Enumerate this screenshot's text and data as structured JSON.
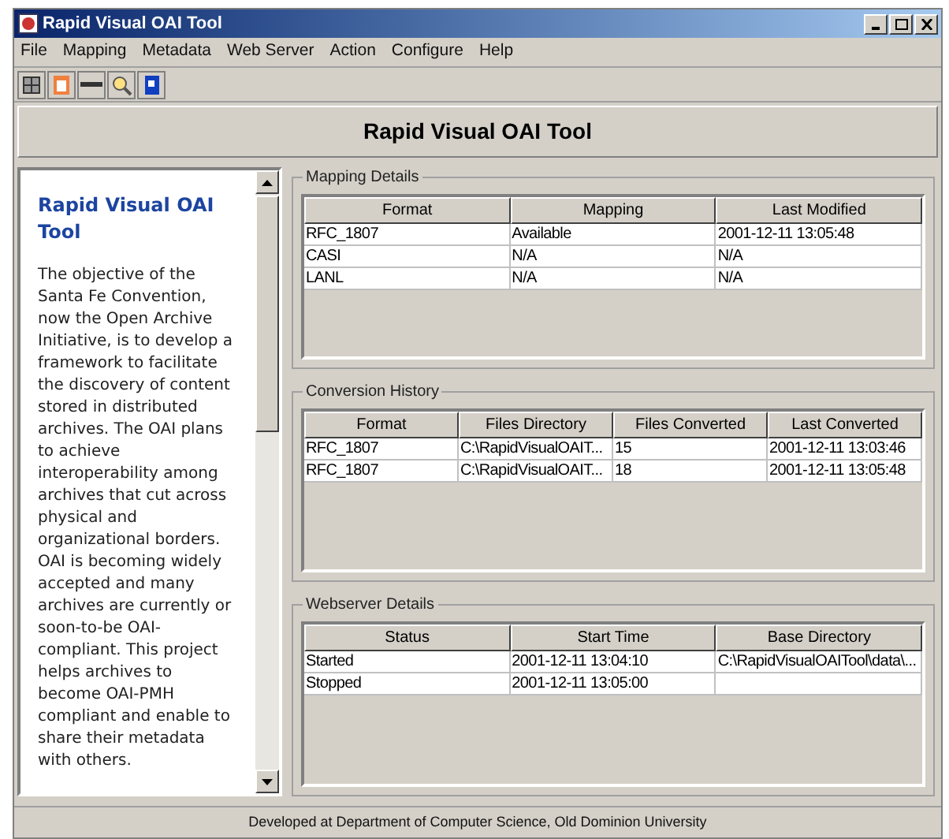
{
  "window": {
    "title": "Rapid Visual OAI Tool"
  },
  "menu": [
    "File",
    "Mapping",
    "Metadata",
    "Web Server",
    "Action",
    "Configure",
    "Help"
  ],
  "header": "Rapid Visual OAI Tool",
  "info": {
    "title": "Rapid Visual OAI Tool",
    "body": "The objective of the Santa Fe Convention, now the Open Archive Initiative, is to develop a framework to facilitate the discovery of content stored in distributed archives. The OAI plans to achieve interoperability among archives that cut across physical and organizational borders. OAI is becoming widely accepted and many archives are currently or soon-to-be OAI-compliant. This project helps archives to become OAI-PMH compliant and enable to share their metadata with others."
  },
  "sections": [
    {
      "title": "Mapping Details",
      "columns": [
        "Format",
        "Mapping",
        "Last Modified"
      ],
      "rows": [
        [
          "RFC_1807",
          "Available",
          "2001-12-11 13:05:48"
        ],
        [
          "CASI",
          "N/A",
          "N/A"
        ],
        [
          "LANL",
          "N/A",
          "N/A"
        ]
      ]
    },
    {
      "title": "Conversion History",
      "columns": [
        "Format",
        "Files Directory",
        "Files Converted",
        "Last Converted"
      ],
      "rows": [
        [
          "RFC_1807",
          "C:\\RapidVisualOAIT...",
          "15",
          "2001-12-11 13:03:46"
        ],
        [
          "RFC_1807",
          "C:\\RapidVisualOAIT...",
          "18",
          "2001-12-11 13:05:48"
        ]
      ]
    },
    {
      "title": "Webserver Details",
      "columns": [
        "Status",
        "Start Time",
        "Base Directory"
      ],
      "rows": [
        [
          "Started",
          "2001-12-11 13:04:10",
          "C:\\RapidVisualOAITool\\data\\..."
        ],
        [
          "Stopped",
          "2001-12-11 13:05:00",
          ""
        ]
      ]
    }
  ],
  "status_bar": "Developed at Department of Computer Science, Old Dominion University"
}
